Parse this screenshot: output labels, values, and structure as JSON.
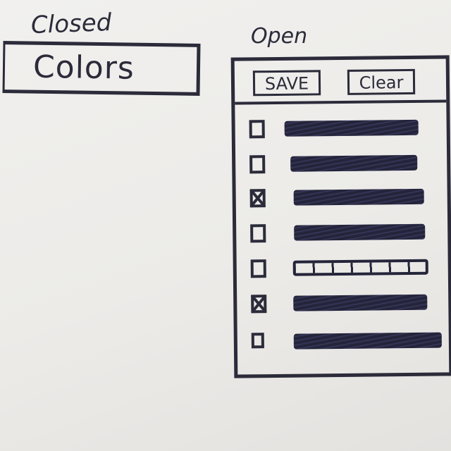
{
  "labels": {
    "closed": "Closed",
    "open": "Open"
  },
  "closed_dropdown": {
    "value": "Colors"
  },
  "open_panel": {
    "save_label": "SAVE",
    "clear_label": "Clear",
    "options": [
      {
        "checked": false
      },
      {
        "checked": false
      },
      {
        "checked": true
      },
      {
        "checked": false
      },
      {
        "checked": false
      },
      {
        "checked": true
      },
      {
        "checked": false
      }
    ]
  },
  "colors": {
    "ink": "#2b2b3a",
    "paper": "#f1f0ee"
  }
}
